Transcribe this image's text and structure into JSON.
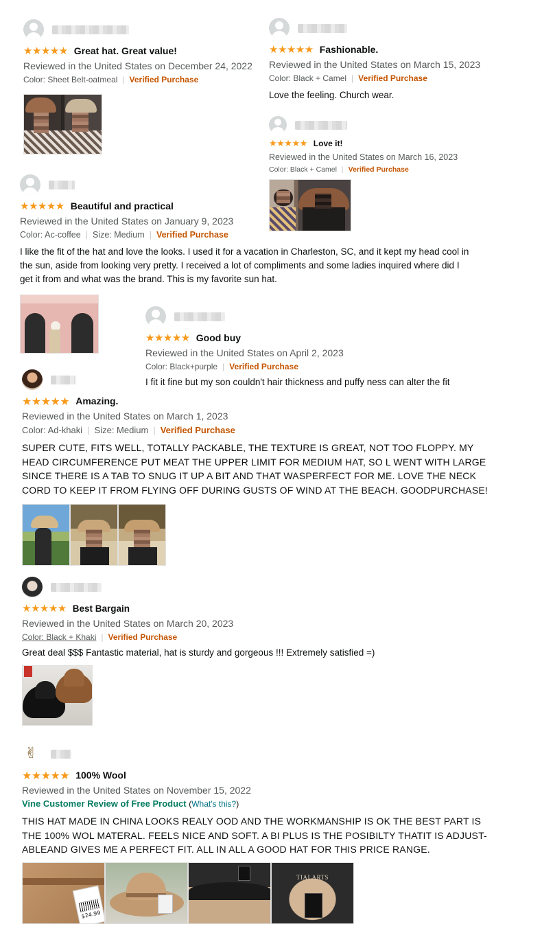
{
  "reviews": [
    {
      "title": "Great hat. Great value!",
      "date": "Reviewed in the United States on December 24, 2022",
      "meta": {
        "color": "Color: Sheet Belt-oatmeal",
        "verified": "Verified Purchase"
      },
      "rating": "★★★★★"
    },
    {
      "title": "Fashionable.",
      "date": "Reviewed in the United States on March 15, 2023",
      "meta": {
        "color": "Color: Black + Camel",
        "verified": "Verified Purchase"
      },
      "text": "Love the feeling. Church wear.",
      "rating": "★★★★★"
    },
    {
      "title": "Love it!",
      "date": "Reviewed in the United States on March 16, 2023",
      "meta": {
        "color": "Color: Black + Camel",
        "verified": "Verified Purchase"
      },
      "rating": "★★★★★"
    },
    {
      "title": "Beautiful and practical",
      "date": "Reviewed in the United States on January 9, 2023",
      "meta": {
        "color": "Color: Ac-coffee",
        "size": "Size: Medium",
        "verified": "Verified Purchase"
      },
      "text": "I like the fit of the hat and love the looks. I used it for a vacation in Charleston, SC, and it kept my head cool in the sun, aside from looking very pretty. I received a lot of compliments and some ladies inquired where did I get it from and what was the brand. This is my favorite sun hat.",
      "rating": "★★★★★"
    },
    {
      "title": "Good buy",
      "date": "Reviewed in the United States on April 2, 2023",
      "meta": {
        "color": "Color: Black+purple",
        "verified": "Verified Purchase"
      },
      "text": "I fit it fine but my son couldn't hair thickness and puffy ness can alter the fit",
      "rating": "★★★★★"
    },
    {
      "title": "Amazing.",
      "date": "Reviewed in the United States on March 1, 2023",
      "meta": {
        "color": "Color: Ad-khaki",
        "size": "Size: Medium",
        "verified": "Verified Purchase"
      },
      "text": "SUPER CUTE, FITS WELL, TOTALLY PACKABLE, THE TEXTURE IS GREAT, NOT TOO FLOPPY. MY HEAD CIRCUMFERENCE PUT MEAT THE UPPER LIMIT FOR MEDIUM HAT, SO L WENT WITH LARGE SINCE THERE IS A TAB TO SNUG IT UP A BIT AND THAT WASPERFECT FOR ME. LOVE THE NECK CORD TO KEEP IT FROM FLYING OFF DURING GUSTS OF WIND AT THE BEACH. GOODPURCHASE!",
      "rating": "★★★★★"
    },
    {
      "title": "Best Bargain",
      "date": "Reviewed in the United States on March 20, 2023",
      "meta": {
        "color": "Color: Black + Khaki",
        "verified": "Verified Purchase"
      },
      "text": "Great deal $$$ Fantastic material, hat is sturdy and gorgeous !!! Extremely satisfied =)",
      "rating": "★★★★★"
    },
    {
      "title": "100% Wool",
      "date": "Reviewed in the United States on November 15, 2022",
      "vine": {
        "label": "Vine Customer Review of Free Product",
        "open": "(",
        "link": "What's this?",
        "close": ")"
      },
      "text": "THIS HAT MADE IN CHINA LOOKS REALY OOD AND THE WORKMANSHIP IS OK THE BEST PART IS THE 100% WOL MATERAL. FEELS NICE AND SOFT. A BI PLUS IS THE POSIBILTY THATIT IS ADJUST-ABLEAND GIVES ME A PERFECT FIT. ALL IN ALL A GOOD HAT FOR THIS PRICE RANGE.",
      "rating": "★★★★★"
    }
  ],
  "photo_text": {
    "price": "$24.99",
    "brand": "TIALARTS"
  },
  "colors": {
    "star": "#f79a1c",
    "verified": "#c45500",
    "vine": "#067d62",
    "link": "#007185",
    "muted": "#565959"
  }
}
